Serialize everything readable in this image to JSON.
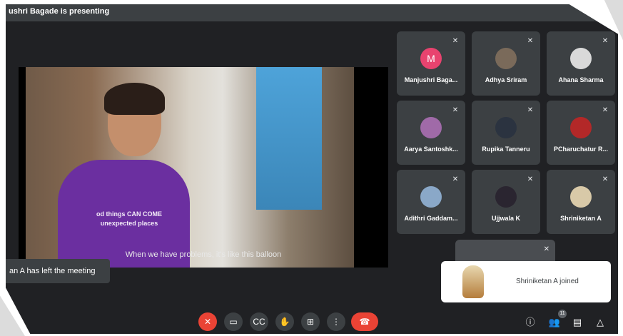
{
  "presenter_banner": "ushri Bagade is presenting",
  "video": {
    "caption": "When we have problems, it's like this balloon",
    "shirt_text_line1": "od things CAN COME",
    "shirt_text_line2": "unexpected places"
  },
  "left_notice": "an A has left the meeting",
  "participants": [
    {
      "name": "Manjushri Baga...",
      "initial": "M",
      "avatar_color": "#e8436f"
    },
    {
      "name": "Adhya Sriram",
      "initial": "",
      "avatar_color": "#7a6a5a"
    },
    {
      "name": "Ahana Sharma",
      "initial": "",
      "avatar_color": "#d9d9d9"
    },
    {
      "name": "Aarya Santoshk...",
      "initial": "",
      "avatar_color": "#a06aa8"
    },
    {
      "name": "Rupika Tanneru",
      "initial": "",
      "avatar_color": "#2b3340"
    },
    {
      "name": "PCharuchatur R...",
      "initial": "",
      "avatar_color": "#b32828"
    },
    {
      "name": "Adithri Gaddam...",
      "initial": "",
      "avatar_color": "#8aa8c8"
    },
    {
      "name": "Ujjwala K",
      "initial": "",
      "avatar_color": "#2a2530"
    },
    {
      "name": "Shriniketan A",
      "initial": "",
      "avatar_color": "#d8c9a8"
    }
  ],
  "joined_toast": "Shriniketan A joined",
  "controls": {
    "mic_icon": "mic-off-icon",
    "camera_icon": "camera-icon",
    "captions_icon": "captions-icon",
    "hand_icon": "raise-hand-icon",
    "present_icon": "present-icon",
    "more_icon": "more-vert-icon",
    "end_icon": "end-call-icon"
  },
  "right_controls": {
    "people_count": "11"
  }
}
